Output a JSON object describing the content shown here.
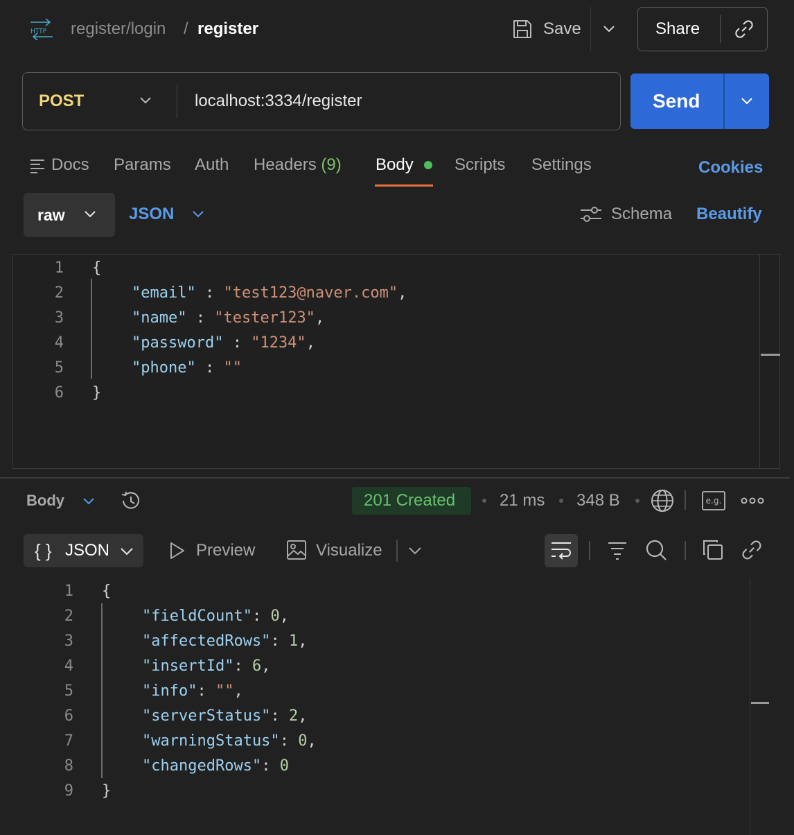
{
  "header": {
    "protocol_icon": "http-icon",
    "breadcrumb_parent": "register/login",
    "breadcrumb_separator": "/",
    "breadcrumb_current": "register",
    "save_label": "Save",
    "share_label": "Share"
  },
  "request": {
    "method": "POST",
    "url": "localhost:3334/register",
    "send_label": "Send"
  },
  "tabs": {
    "docs": "Docs",
    "params": "Params",
    "auth": "Auth",
    "headers": "Headers",
    "headers_count": "(9)",
    "body": "Body",
    "scripts": "Scripts",
    "settings": "Settings",
    "cookies": "Cookies",
    "active": "Body"
  },
  "body_toolbar": {
    "mode": "raw",
    "format": "JSON",
    "schema": "Schema",
    "beautify": "Beautify"
  },
  "request_body": {
    "line_numbers": [
      "1",
      "2",
      "3",
      "4",
      "5",
      "6"
    ],
    "lines": [
      {
        "text": "{"
      },
      {
        "key": "\"email\"",
        "sep": " : ",
        "value": "\"test123@naver.com\"",
        "end": ","
      },
      {
        "key": "\"name\"",
        "sep": " : ",
        "value": "\"tester123\"",
        "end": ","
      },
      {
        "key": "\"password\"",
        "sep": " : ",
        "value": "\"1234\"",
        "end": ","
      },
      {
        "key": "\"phone\"",
        "sep": " : ",
        "value": "\"\"",
        "end": ""
      },
      {
        "text": "}"
      }
    ]
  },
  "response": {
    "section_label": "Body",
    "status": "201 Created",
    "time": "21 ms",
    "size": "348 B",
    "status_color": "#66c26f",
    "view_mode_glyph": "{ }",
    "view_mode": "JSON",
    "preview": "Preview",
    "visualize": "Visualize",
    "eg_label": "e.g.",
    "line_numbers": [
      "1",
      "2",
      "3",
      "4",
      "5",
      "6",
      "7",
      "8",
      "9"
    ],
    "lines": [
      {
        "text": "{"
      },
      {
        "key": "\"fieldCount\"",
        "sep": ": ",
        "value": "0",
        "end": ","
      },
      {
        "key": "\"affectedRows\"",
        "sep": ": ",
        "value": "1",
        "end": ","
      },
      {
        "key": "\"insertId\"",
        "sep": ": ",
        "value": "6",
        "end": ","
      },
      {
        "key": "\"info\"",
        "sep": ": ",
        "value": "\"\"",
        "end": ","
      },
      {
        "key": "\"serverStatus\"",
        "sep": ": ",
        "value": "2",
        "end": ","
      },
      {
        "key": "\"warningStatus\"",
        "sep": ": ",
        "value": "0",
        "end": ","
      },
      {
        "key": "\"changedRows\"",
        "sep": ": ",
        "value": "0",
        "end": ""
      },
      {
        "text": "}"
      }
    ]
  },
  "colors": {
    "accent_blue": "#2d6ad8",
    "link_blue": "#5a9be8",
    "method_yellow": "#f1d77a",
    "active_tab_underline": "#e5733a",
    "status_green": "#66c26f",
    "json_key": "#9dd1f0",
    "json_string": "#ce9178",
    "json_number": "#b5cea8"
  }
}
